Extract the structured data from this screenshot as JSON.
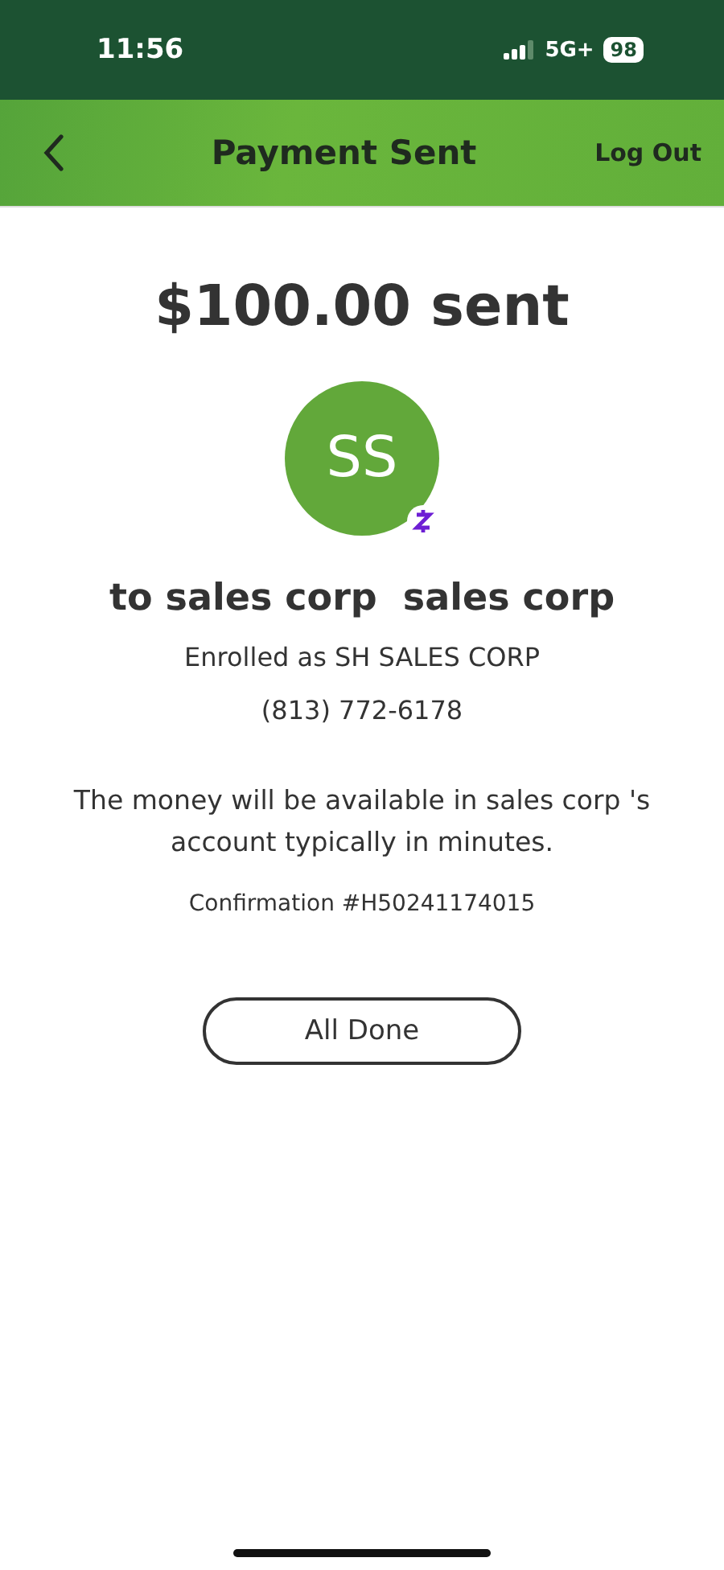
{
  "status_bar": {
    "time": "11:56",
    "network": "5G+",
    "battery": "98"
  },
  "header": {
    "title": "Payment Sent",
    "action": "Log Out"
  },
  "amount": "$100.00 sent",
  "recipient": {
    "initials": "SS",
    "name": "to sales corp  sales corp",
    "enrolled": "Enrolled as SH SALES CORP",
    "phone": "(813) 772-6178"
  },
  "message": "The money will be available in sales corp 's account typically in minutes.",
  "confirmation": "Confirmation #H50241174015",
  "button": "All Done"
}
